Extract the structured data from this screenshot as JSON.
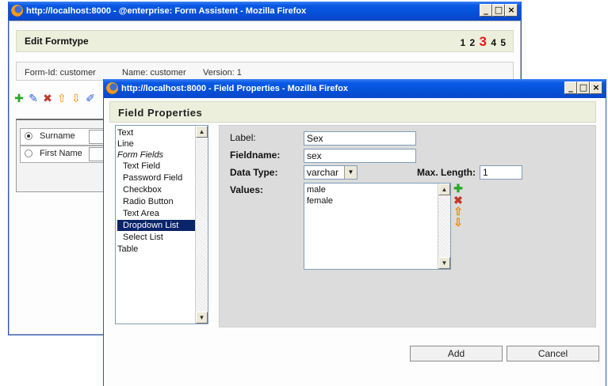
{
  "back_window": {
    "title": "http://localhost:8000 - @enterprise: Form Assistent - Mozilla Firefox",
    "controls": {
      "minimize": "_",
      "maximize": "□",
      "close": "×"
    },
    "heading": "Edit Formtype",
    "steps": {
      "before": "1 2 ",
      "current": "3",
      "after": " 4 5"
    },
    "info": {
      "form_id": "Form-Id: customer",
      "name": "Name: customer",
      "version": "Version: 1"
    },
    "toolbar_icons": [
      "add-icon",
      "edit-icon",
      "delete-icon",
      "move-up-icon",
      "move-down-icon",
      "edit-form-icon"
    ],
    "rows": [
      {
        "label": "Surname",
        "selected": true
      },
      {
        "label": "First Name",
        "selected": false
      }
    ]
  },
  "front_window": {
    "title": "http://localhost:8000 - Field Properties - Mozilla Firefox",
    "controls": {
      "minimize": "_",
      "maximize": "□",
      "close": "×"
    },
    "heading": "Field Properties",
    "palette": {
      "items": [
        {
          "label": "Text",
          "style": "top"
        },
        {
          "label": "Line",
          "style": "top"
        },
        {
          "label": "Form Fields",
          "style": "italic"
        },
        {
          "label": "Text Field",
          "style": "sub"
        },
        {
          "label": "Password Field",
          "style": "sub"
        },
        {
          "label": "Checkbox",
          "style": "sub"
        },
        {
          "label": "Radio Button",
          "style": "sub"
        },
        {
          "label": "Text Area",
          "style": "sub"
        },
        {
          "label": "Dropdown List",
          "style": "selected"
        },
        {
          "label": "Select List",
          "style": "sub"
        },
        {
          "label": "Table",
          "style": "top"
        }
      ]
    },
    "form": {
      "label_caption": "Label:",
      "label_value": "Sex",
      "fieldname_caption": "Fieldname:",
      "fieldname_value": "sex",
      "datatype_caption": "Data Type:",
      "datatype_value": "varchar",
      "maxlength_caption": "Max. Length:",
      "maxlength_value": "1",
      "values_caption": "Values:",
      "values": [
        "male",
        "female"
      ]
    },
    "buttons": {
      "add": "Add",
      "cancel": "Cancel"
    },
    "value_controls": [
      "add-icon",
      "delete-icon",
      "move-up-icon",
      "move-down-icon"
    ]
  },
  "colors": {
    "titlebar": "#0a5ae6",
    "header_bg": "#ecefdc",
    "selection": "#0a246a",
    "step_current": "#e8141a",
    "panel_bg": "#dcdcdc"
  }
}
